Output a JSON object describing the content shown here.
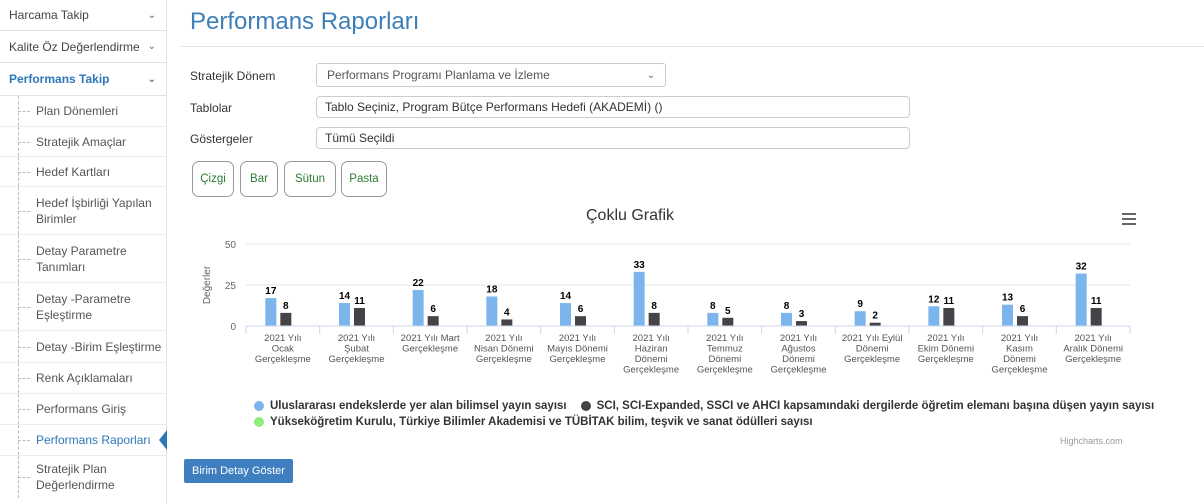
{
  "sidebar": {
    "top_items": [
      {
        "label": "Harcama Takip"
      },
      {
        "label": "Kalite Öz Değerlendirme"
      },
      {
        "label": "Performans Takip"
      }
    ],
    "sub_items": [
      {
        "label": "Plan Dönemleri"
      },
      {
        "label": "Stratejik Amaçlar"
      },
      {
        "label": "Hedef Kartları"
      },
      {
        "label": "Hedef İşbirliği Yapılan Birimler"
      },
      {
        "label": "Detay Parametre Tanımları"
      },
      {
        "label": "Detay -Parametre Eşleştirme"
      },
      {
        "label": "Detay -Birim Eşleştirme"
      },
      {
        "label": "Renk Açıklamaları"
      },
      {
        "label": "Performans Giriş"
      },
      {
        "label": "Performans Raporları"
      },
      {
        "label": "Stratejik Plan Değerlendirme"
      }
    ]
  },
  "page": {
    "title": "Performans Raporları",
    "labels": {
      "period": "Stratejik Dönem",
      "tables": "Tablolar",
      "indicators": "Göstergeler"
    },
    "period_value": "Performans Programı Planlama ve İzleme",
    "tables_value": "Tablo Seçiniz, Program Bütçe Performans Hedefi (AKADEMİ) ()",
    "indicators_value": "Tümü Seçildi",
    "chart_buttons": [
      "Çizgi",
      "Bar",
      "Sütun",
      "Pasta"
    ],
    "detail_button": "Birim Detay Göster",
    "credits": "Highcharts.com"
  },
  "colors": {
    "blue": "#7cb5ec",
    "dark": "#434348",
    "green": "#90ed7d",
    "accent": "#2e77b8"
  },
  "chart_data": {
    "type": "bar",
    "title": "Çoklu Grafik",
    "ylabel": "Değerler",
    "ylim": [
      0,
      50
    ],
    "yticks": [
      "50",
      "25",
      "0"
    ],
    "categories": [
      [
        "2021 Yılı",
        "Ocak",
        "Gerçekleşme"
      ],
      [
        "2021 Yılı",
        "Şubat",
        "Gerçekleşme"
      ],
      [
        "2021 Yılı Mart",
        "Gerçekleşme"
      ],
      [
        "2021 Yılı",
        "Nisan Dönemi",
        "Gerçekleşme"
      ],
      [
        "2021 Yılı",
        "Mayıs Dönemi",
        "Gerçekleşme"
      ],
      [
        "2021 Yılı",
        "Haziran",
        "Dönemi",
        "Gerçekleşme"
      ],
      [
        "2021 Yılı",
        "Temmuz",
        "Dönemi",
        "Gerçekleşme"
      ],
      [
        "2021 Yılı",
        "Ağustos",
        "Dönemi",
        "Gerçekleşme"
      ],
      [
        "2021 Yılı Eylül",
        "Dönemi",
        "Gerçekleşme"
      ],
      [
        "2021 Yılı",
        "Ekim Dönemi",
        "Gerçekleşme"
      ],
      [
        "2021 Yılı",
        "Kasım",
        "Dönemi",
        "Gerçekleşme"
      ],
      [
        "2021 Yılı",
        "Aralık Dönemi",
        "Gerçekleşme"
      ]
    ],
    "series": [
      {
        "name": "Uluslararası endekslerde yer alan bilimsel yayın sayısı",
        "color": "#7cb5ec",
        "values": [
          17,
          14,
          22,
          18,
          14,
          33,
          8,
          8,
          9,
          12,
          13,
          32
        ]
      },
      {
        "name": "SCI, SCI-Expanded, SSCI ve AHCI kapsamındaki dergilerde öğretim elemanı başına düşen yayın sayısı",
        "color": "#434348",
        "values": [
          8,
          11,
          6,
          4,
          6,
          8,
          5,
          3,
          2,
          11,
          6,
          11
        ]
      },
      {
        "name": "Yükseköğretim Kurulu, Türkiye Bilimler Akademisi ve TÜBİTAK bilim, teşvik ve sanat ödülleri sayısı",
        "color": "#90ed7d",
        "values": [
          0,
          0,
          0,
          0,
          0,
          0,
          0,
          0,
          0,
          0,
          0,
          0
        ]
      }
    ]
  }
}
